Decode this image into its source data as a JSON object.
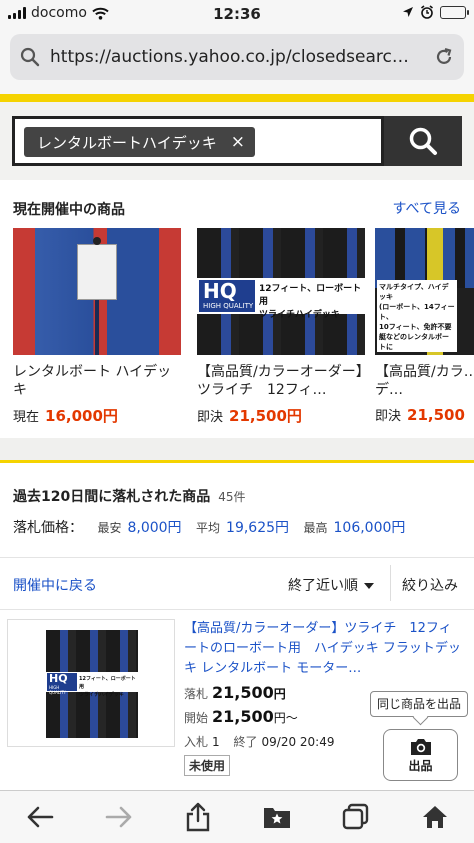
{
  "status_bar": {
    "carrier": "docomo",
    "time": "12:36"
  },
  "url_bar": {
    "url": "https://auctions.yahoo.co.jp/closedsearc…"
  },
  "search": {
    "query_chip": "レンタルボートハイデッキ",
    "chip_close": "×"
  },
  "current_section": {
    "title": "現在開催中の商品",
    "see_all": "すべて見る",
    "items": [
      {
        "title": "レンタルボート ハイデッキ",
        "price_label": "現在",
        "price": "16,000円"
      },
      {
        "title": "【高品質/カラーオーダー】ツライチ　12フィ…",
        "price_label": "即決",
        "price": "21,500円"
      },
      {
        "title": "【高品質/カラ…】ミドルデ…",
        "price_label": "即決",
        "price": "21,500"
      }
    ],
    "hq_badge": "HQ",
    "hq_sub": "HIGH QUALITY",
    "hq_caption1": "12フィート、ローボート用",
    "hq_caption2": "ツライチハイデッキ",
    "third_caption": [
      "マルチタイプ、ハイデッキ",
      "(ローボート、14フィート、",
      "10フィート、免許不要",
      "艇などのレンタルボートに"
    ]
  },
  "closed_section": {
    "title": "過去120日間に落札された商品",
    "count": "45件",
    "price_label": "落札価格：",
    "min_label": "最安",
    "min_value": "8,000円",
    "avg_label": "平均",
    "avg_value": "19,625円",
    "max_label": "最高",
    "max_value": "106,000円",
    "back_link": "開催中に戻る",
    "sort_label": "終了近い順",
    "filter_label": "絞り込み",
    "item": {
      "title": "【高品質/カラーオーダー】ツライチ　12フィートのローボート用　ハイデッキ フラットデッキ レンタルボート モーター…",
      "sold_label": "落札",
      "sold_price": "21,500",
      "sold_yen": "円",
      "start_label": "開始",
      "start_price": "21,500",
      "start_yen": "円〜",
      "bids_label": "入札",
      "bids_value": "1",
      "end_label": "終了",
      "end_value": "09/20 20:49",
      "condition": "未使用",
      "tooltip": "同じ商品を出品",
      "list_button": "出品"
    }
  },
  "colors": {
    "yahoo_yellow": "#f5d300",
    "link_blue": "#1b52c7",
    "price_red": "#e33800",
    "boat_blue": "#2a4f9c",
    "boat_red": "#c63a34"
  }
}
